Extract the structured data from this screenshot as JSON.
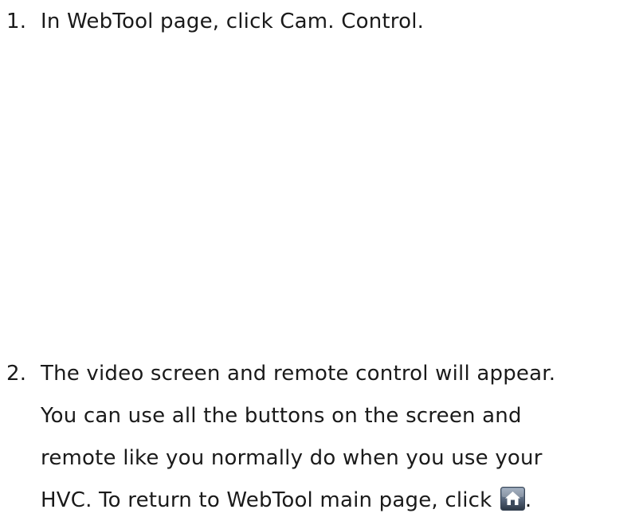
{
  "steps": [
    {
      "number": "1.",
      "lines": [
        "In WebTool page, click Cam. Control."
      ]
    },
    {
      "number": "2.",
      "lines": [
        "The video screen and remote control will appear.",
        "You can use all the buttons on the screen and",
        "remote like you normally do when you use your",
        "HVC. To return to WebTool main page, click"
      ],
      "trailing_icon": "home-icon",
      "trailing_text": "."
    }
  ],
  "colors": {
    "text": "#1a1a1a",
    "icon_gradient_top": "#8a9bb0",
    "icon_gradient_bottom": "#2b3644"
  }
}
